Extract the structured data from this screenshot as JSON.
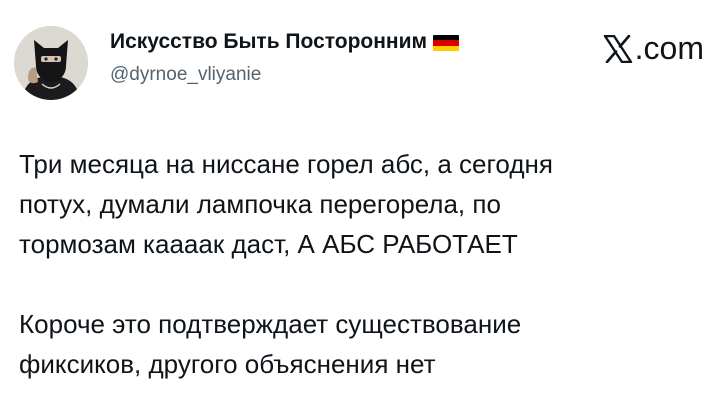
{
  "author": {
    "display_name": "Искусство Быть Посторонним",
    "flag_colors": [
      "#000000",
      "#dd0000",
      "#ffce00"
    ],
    "handle": "@dyrnoe_vliyanie"
  },
  "brand": {
    "label": ".com",
    "icon": "x-logo-icon"
  },
  "tweet": {
    "paragraphs": [
      {
        "lines": [
          "Три месяца на ниссане горел абс, а сегодня",
          "потух, думали лампочка перегорела, по",
          "тормозам кааaак даст, А АБС РАБОТАЕТ"
        ]
      },
      {
        "lines": [
          "Короче это подтверждает существование",
          "фиксиков, другого объяснения нет"
        ]
      }
    ]
  }
}
